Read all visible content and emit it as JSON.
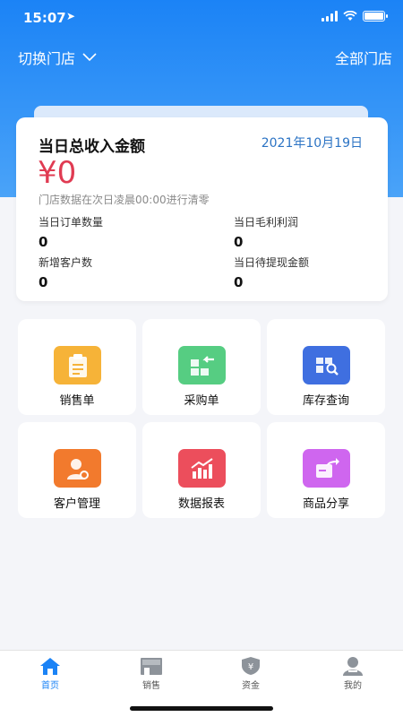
{
  "status": {
    "time": "15:07",
    "battery_level": 1.0
  },
  "header": {
    "switch_store_label": "切换门店",
    "all_stores_label": "全部门店"
  },
  "summary": {
    "title": "当日总收入金额",
    "date": "2021年10月19日",
    "amount": "¥0",
    "note": "门店数据在次日凌晨00:00进行清零",
    "stats": [
      {
        "label": "当日订单数量",
        "value": "0"
      },
      {
        "label": "当日毛利利润",
        "value": "0"
      },
      {
        "label": "新增客户数",
        "value": "0"
      },
      {
        "label": "当日待提现金额",
        "value": "0"
      }
    ]
  },
  "tiles": [
    {
      "label": "销售单",
      "icon": "clipboard-icon",
      "color": "#f6b338"
    },
    {
      "label": "采购单",
      "icon": "purchase-icon",
      "color": "#56cd82"
    },
    {
      "label": "库存查询",
      "icon": "inventory-search-icon",
      "color": "#3f6fe0"
    },
    {
      "label": "客户管理",
      "icon": "customer-icon",
      "color": "#f27a2d"
    },
    {
      "label": "数据报表",
      "icon": "chart-icon",
      "color": "#ec4e5c"
    },
    {
      "label": "商品分享",
      "icon": "share-icon",
      "color": "#cf66ef"
    }
  ],
  "tabbar": {
    "items": [
      {
        "label": "首页",
        "icon": "home-icon",
        "active": true
      },
      {
        "label": "销售",
        "icon": "store-icon",
        "active": false
      },
      {
        "label": "资金",
        "icon": "funds-shield-icon",
        "active": false
      },
      {
        "label": "我的",
        "icon": "profile-icon",
        "active": false
      }
    ]
  },
  "colors": {
    "primary": "#1b83f6",
    "amount": "#e03b52",
    "date": "#2b73c4",
    "inactive_tab": "#9aa0a6"
  }
}
